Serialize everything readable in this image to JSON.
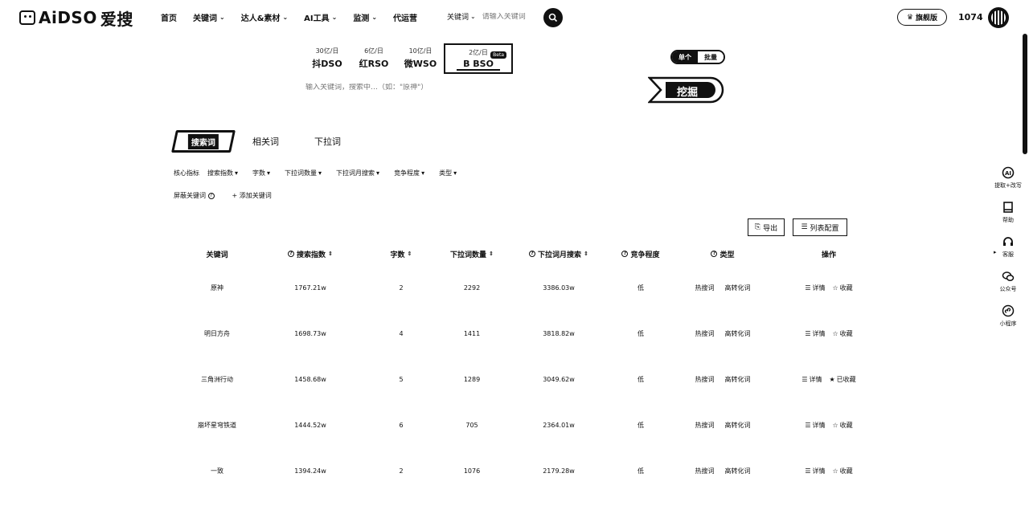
{
  "brand": {
    "logo_text": "AiDSO",
    "logo_cn": "爱搜"
  },
  "nav": [
    {
      "label": "首页",
      "has_menu": false
    },
    {
      "label": "关键词",
      "has_menu": true
    },
    {
      "label": "达人&素材",
      "has_menu": true
    },
    {
      "label": "AI工具",
      "has_menu": true
    },
    {
      "label": "监测",
      "has_menu": true
    },
    {
      "label": "代运营",
      "has_menu": false
    }
  ],
  "top_search": {
    "scope": "关键词",
    "placeholder": "请输入关键词"
  },
  "header_right": {
    "vip_label": "旗舰版",
    "user_number": "1074"
  },
  "engines": [
    {
      "daily": "30亿/日",
      "name": "抖DSO",
      "active": false
    },
    {
      "daily": "6亿/日",
      "name": "红RSO",
      "active": false
    },
    {
      "daily": "10亿/日",
      "name": "微WSO",
      "active": false
    },
    {
      "daily": "2亿/日",
      "name": "B BSO",
      "active": true,
      "badge": "Beta"
    }
  ],
  "main_search": {
    "placeholder": "输入关键词，搜索中…（如：\"原神\"）"
  },
  "mode_toggle": {
    "single": "单个",
    "batch": "批量"
  },
  "dig_button": "挖掘",
  "subtabs": {
    "active": "搜索词",
    "related": "相关词",
    "dropdown": "下拉词"
  },
  "filters": {
    "label": "核心指标",
    "items": [
      "搜索指数",
      "字数",
      "下拉词数量",
      "下拉词月搜索",
      "竞争程度",
      "类型"
    ],
    "filter_keywords": "屏蔽关键词",
    "add_keyword": "+ 添加关键词"
  },
  "toolbar": {
    "export": "导出",
    "columns": "列表配置"
  },
  "table": {
    "headers": [
      "关键词",
      "搜索指数",
      "字数",
      "下拉词数量",
      "下拉词月搜索",
      "竞争程度",
      "类型",
      "操作"
    ],
    "tag_hot": "热搜词",
    "tag_convert": "高转化词",
    "action_detail": "详情",
    "action_fav": "收藏",
    "action_faved": "已收藏",
    "rows": [
      {
        "keyword": "原神",
        "index": "1767.21w",
        "chars": "2",
        "dropdown_count": "2292",
        "monthly": "3386.03w",
        "competition": "低",
        "favorited": false
      },
      {
        "keyword": "明日方舟",
        "index": "1698.73w",
        "chars": "4",
        "dropdown_count": "1411",
        "monthly": "3818.82w",
        "competition": "低",
        "favorited": false
      },
      {
        "keyword": "三角洲行动",
        "index": "1458.68w",
        "chars": "5",
        "dropdown_count": "1289",
        "monthly": "3049.62w",
        "competition": "低",
        "favorited": true
      },
      {
        "keyword": "崩坏星穹铁道",
        "index": "1444.52w",
        "chars": "6",
        "dropdown_count": "705",
        "monthly": "2364.01w",
        "competition": "低",
        "favorited": false
      },
      {
        "keyword": "一致",
        "index": "1394.24w",
        "chars": "2",
        "dropdown_count": "1076",
        "monthly": "2179.28w",
        "competition": "低",
        "favorited": false
      }
    ]
  },
  "right_sidebar": [
    {
      "label": "提取+改写",
      "icon": "ai-icon"
    },
    {
      "label": "帮助",
      "icon": "book-icon"
    },
    {
      "label": "客服",
      "icon": "headset-icon"
    },
    {
      "label": "公众号",
      "icon": "wechat-icon"
    },
    {
      "label": "小程序",
      "icon": "miniprogram-icon"
    }
  ]
}
